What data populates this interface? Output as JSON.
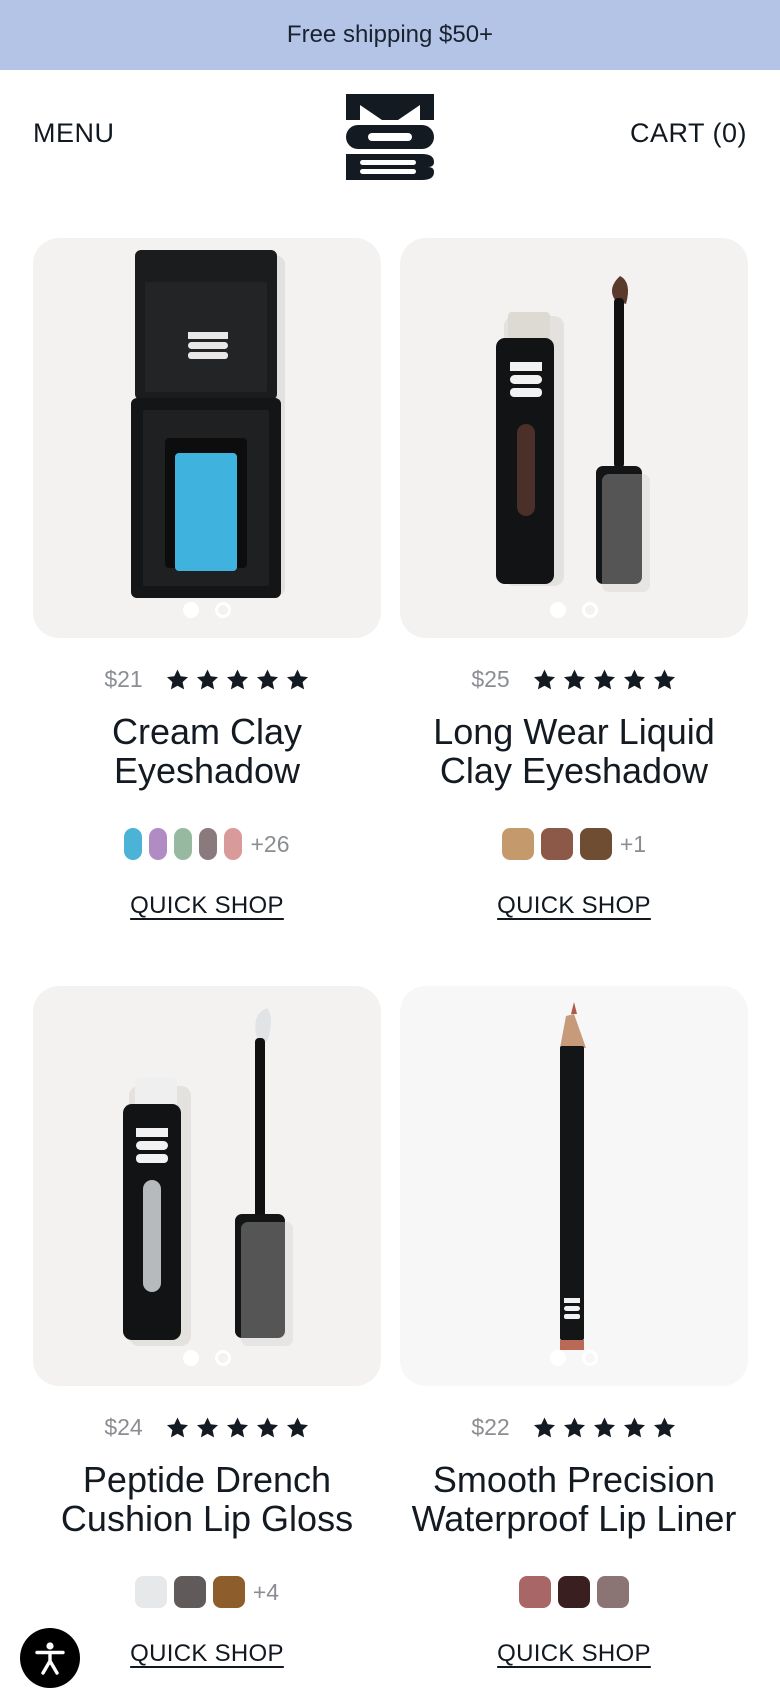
{
  "promo": {
    "text": "Free shipping $50+"
  },
  "header": {
    "menu_label": "MENU",
    "cart_label": "CART (0)",
    "logo_text": "MOB"
  },
  "products": [
    {
      "price": "$21",
      "rating": 5,
      "name_line1": "Cream Clay",
      "name_line2": "Eyeshadow",
      "swatches": [
        "#4ab3d6",
        "#b18cc4",
        "#97b9a0",
        "#8a7a7d",
        "#d99a9a"
      ],
      "more": "+26",
      "quick_shop": "QUICK SHOP",
      "image_dots": 2,
      "active_dot": 0
    },
    {
      "price": "$25",
      "rating": 5,
      "name_line1": "Long Wear Liquid",
      "name_line2": "Clay Eyeshadow",
      "swatches": [
        "#c49a6c",
        "#8c5847",
        "#6e4d33"
      ],
      "more": "+1",
      "quick_shop": "QUICK SHOP",
      "image_dots": 2,
      "active_dot": 0
    },
    {
      "price": "$24",
      "rating": 5,
      "name_line1": "Peptide Drench",
      "name_line2": "Cushion Lip Gloss",
      "swatches": [
        "#e6e8ea",
        "#605a5a",
        "#8d5d2c"
      ],
      "more": "+4",
      "quick_shop": "QUICK SHOP",
      "image_dots": 2,
      "active_dot": 0
    },
    {
      "price": "$22",
      "rating": 5,
      "name_line1": "Smooth Precision",
      "name_line2": "Waterproof Lip Liner",
      "swatches": [
        "#a86766",
        "#3a1f20",
        "#8a7474"
      ],
      "more": "",
      "quick_shop": "QUICK SHOP",
      "image_dots": 2,
      "active_dot": 0
    }
  ],
  "accessibility": {
    "icon": "accessibility-icon"
  },
  "colors": {
    "promo_bg": "#b3c4e6",
    "text": "#111820",
    "muted": "#8a8d91",
    "card_bg": "#f3f2f0"
  }
}
